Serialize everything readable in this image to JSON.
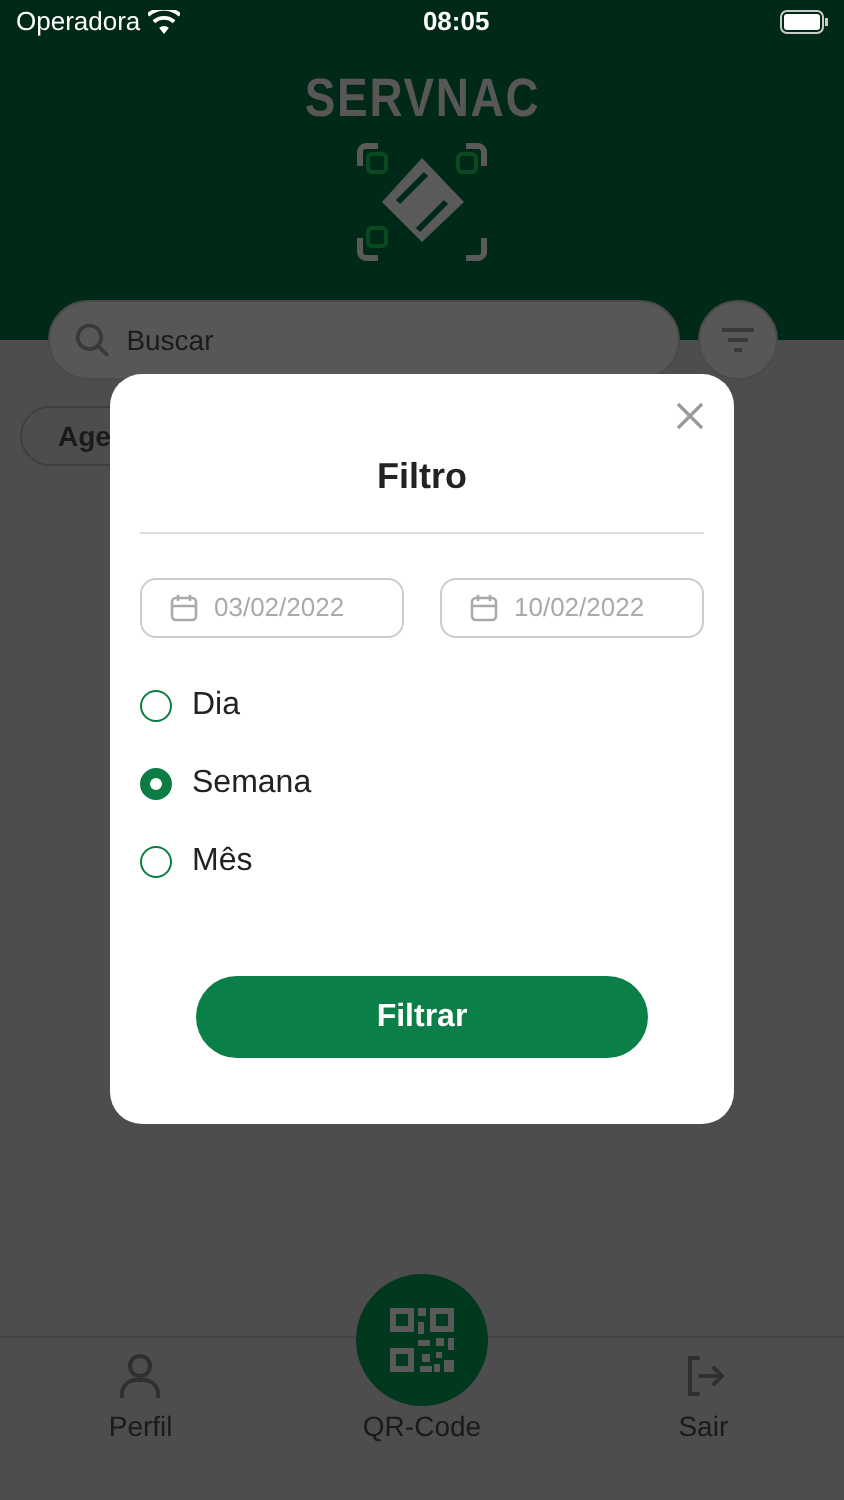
{
  "status_bar": {
    "carrier": "Operadora",
    "time": "08:05"
  },
  "header": {
    "logo_text": "SERVNAC"
  },
  "search": {
    "placeholder": "Buscar"
  },
  "chip": {
    "label": "Age"
  },
  "dialog": {
    "title": "Filtro",
    "date_fields": [
      {
        "value": "03/02/2022"
      },
      {
        "value": "10/02/2022"
      }
    ],
    "options": [
      {
        "label": "Dia",
        "selected": false
      },
      {
        "label": "Semana",
        "selected": true
      },
      {
        "label": "Mês",
        "selected": false
      }
    ],
    "button": "Filtrar"
  },
  "nav": [
    {
      "kind": "profile",
      "label": "Perfil"
    },
    {
      "kind": "qr",
      "label": "QR-Code"
    },
    {
      "kind": "exit",
      "label": "Sair"
    }
  ]
}
